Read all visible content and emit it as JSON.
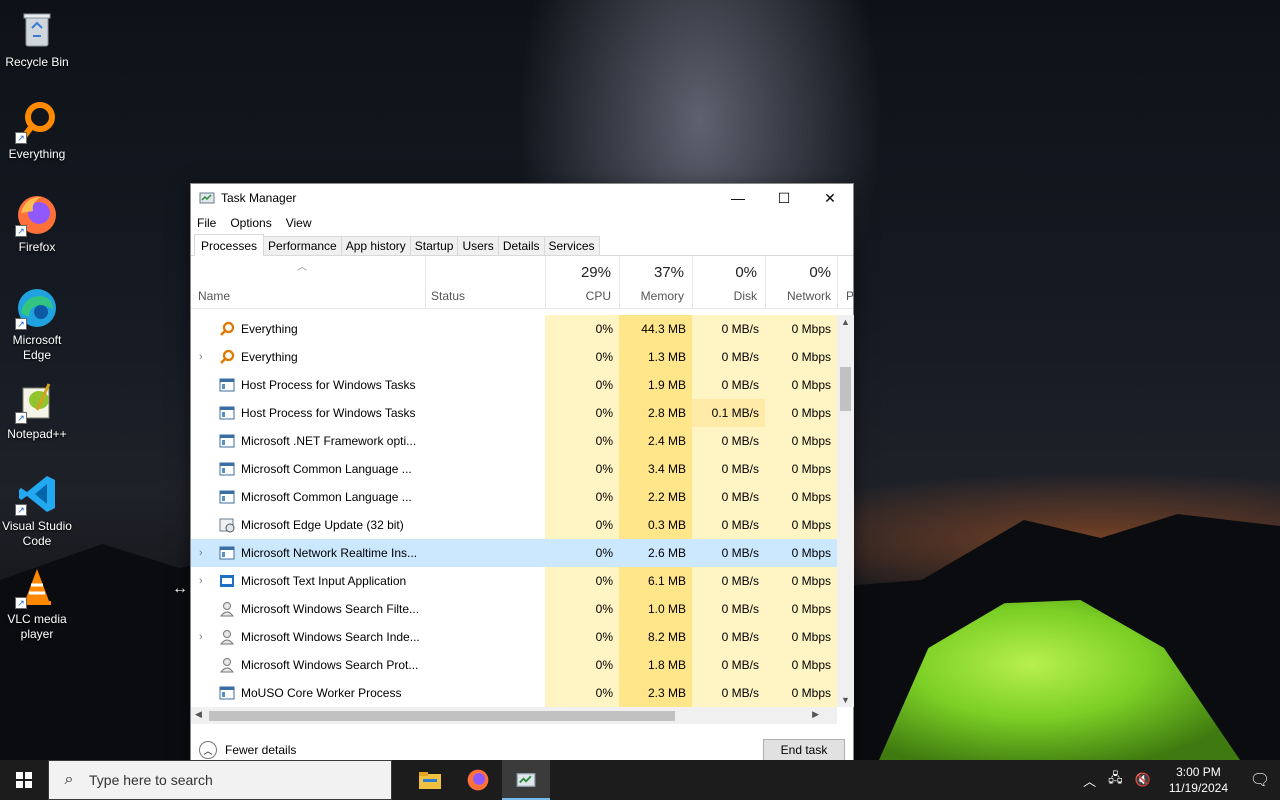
{
  "desktop": {
    "icons": [
      {
        "label": "Recycle Bin",
        "icon": "recycle-bin-icon"
      },
      {
        "label": "Everything",
        "icon": "everything-icon"
      },
      {
        "label": "Firefox",
        "icon": "firefox-icon"
      },
      {
        "label": "Microsoft Edge",
        "icon": "edge-icon"
      },
      {
        "label": "Notepad++",
        "icon": "notepadpp-icon"
      },
      {
        "label": "Visual Studio Code",
        "icon": "vscode-icon"
      },
      {
        "label": "VLC media player",
        "icon": "vlc-icon"
      }
    ]
  },
  "window": {
    "title": "Task Manager",
    "minimize": "—",
    "maximize": "☐",
    "close": "✕"
  },
  "menu": [
    "File",
    "Options",
    "View"
  ],
  "tabs": [
    "Processes",
    "Performance",
    "App history",
    "Startup",
    "Users",
    "Details",
    "Services"
  ],
  "active_tab": "Processes",
  "columns": {
    "name": "Name",
    "status": "Status",
    "cpu": {
      "label": "CPU",
      "pct": "29%"
    },
    "memory": {
      "label": "Memory",
      "pct": "37%"
    },
    "disk": {
      "label": "Disk",
      "pct": "0%"
    },
    "network": {
      "label": "Network",
      "pct": "0%"
    },
    "partial": "P"
  },
  "processes": [
    {
      "name": "Everything",
      "expand": "",
      "icon": "everything-icon",
      "cpu": "0%",
      "memory": "44.3 MB",
      "disk": "0 MB/s",
      "network": "0 Mbps"
    },
    {
      "name": "Everything",
      "expand": "›",
      "icon": "everything-icon",
      "cpu": "0%",
      "memory": "1.3 MB",
      "disk": "0 MB/s",
      "network": "0 Mbps"
    },
    {
      "name": "Host Process for Windows Tasks",
      "expand": "",
      "icon": "window-icon",
      "cpu": "0%",
      "memory": "1.9 MB",
      "disk": "0 MB/s",
      "network": "0 Mbps"
    },
    {
      "name": "Host Process for Windows Tasks",
      "expand": "",
      "icon": "window-icon",
      "cpu": "0%",
      "memory": "2.8 MB",
      "disk": "0.1 MB/s",
      "network": "0 Mbps"
    },
    {
      "name": "Microsoft .NET Framework opti...",
      "expand": "",
      "icon": "window-icon",
      "cpu": "0%",
      "memory": "2.4 MB",
      "disk": "0 MB/s",
      "network": "0 Mbps"
    },
    {
      "name": "Microsoft Common Language ...",
      "expand": "",
      "icon": "window-icon",
      "cpu": "0%",
      "memory": "3.4 MB",
      "disk": "0 MB/s",
      "network": "0 Mbps"
    },
    {
      "name": "Microsoft Common Language ...",
      "expand": "",
      "icon": "window-icon",
      "cpu": "0%",
      "memory": "2.2 MB",
      "disk": "0 MB/s",
      "network": "0 Mbps"
    },
    {
      "name": "Microsoft Edge Update (32 bit)",
      "expand": "",
      "icon": "edge-update-icon",
      "cpu": "0%",
      "memory": "0.3 MB",
      "disk": "0 MB/s",
      "network": "0 Mbps"
    },
    {
      "name": "Microsoft Network Realtime Ins...",
      "expand": "›",
      "icon": "window-icon",
      "cpu": "0%",
      "memory": "2.6 MB",
      "disk": "0 MB/s",
      "network": "0 Mbps",
      "selected": true
    },
    {
      "name": "Microsoft Text Input Application",
      "expand": "›",
      "icon": "text-input-icon",
      "cpu": "0%",
      "memory": "6.1 MB",
      "disk": "0 MB/s",
      "network": "0 Mbps"
    },
    {
      "name": "Microsoft Windows Search Filte...",
      "expand": "",
      "icon": "search-user-icon",
      "cpu": "0%",
      "memory": "1.0 MB",
      "disk": "0 MB/s",
      "network": "0 Mbps"
    },
    {
      "name": "Microsoft Windows Search Inde...",
      "expand": "›",
      "icon": "search-user-icon",
      "cpu": "0%",
      "memory": "8.2 MB",
      "disk": "0 MB/s",
      "network": "0 Mbps"
    },
    {
      "name": "Microsoft Windows Search Prot...",
      "expand": "",
      "icon": "search-user-icon",
      "cpu": "0%",
      "memory": "1.8 MB",
      "disk": "0 MB/s",
      "network": "0 Mbps"
    },
    {
      "name": "MoUSO Core Worker Process",
      "expand": "",
      "icon": "window-icon",
      "cpu": "0%",
      "memory": "2.3 MB",
      "disk": "0 MB/s",
      "network": "0 Mbps"
    }
  ],
  "footer": {
    "fewer_details": "Fewer details",
    "end_task": "End task"
  },
  "taskbar": {
    "search_placeholder": "Type here to search",
    "apps": [
      "file-explorer-icon",
      "firefox-icon",
      "task-manager-icon"
    ],
    "time": "3:00 PM",
    "date": "11/19/2024"
  }
}
